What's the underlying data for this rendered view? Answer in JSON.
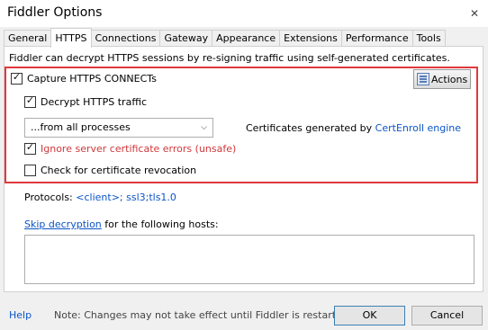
{
  "window": {
    "title": "Fiddler Options",
    "close_glyph": "✕"
  },
  "tabs": [
    {
      "label": "General"
    },
    {
      "label": "HTTPS"
    },
    {
      "label": "Connections"
    },
    {
      "label": "Gateway"
    },
    {
      "label": "Appearance"
    },
    {
      "label": "Extensions"
    },
    {
      "label": "Performance"
    },
    {
      "label": "Tools"
    }
  ],
  "https": {
    "intro": "Fiddler can decrypt HTTPS sessions by re-signing traffic using self-generated certificates.",
    "capture": {
      "label": "Capture HTTPS CONNECTs",
      "checked": true
    },
    "actions_label": "Actions",
    "decrypt": {
      "label": "Decrypt HTTPS traffic",
      "checked": true
    },
    "process_filter": {
      "value": "...from all processes",
      "arrow": "⌵"
    },
    "certs_prefix": "Certificates generated by ",
    "certs_link": "CertEnroll engine",
    "ignore_errors": {
      "label": "Ignore server certificate errors (unsafe)",
      "checked": true
    },
    "revocation": {
      "label": "Check for certificate revocation",
      "checked": false
    },
    "protocols_label": "Protocols: ",
    "protocols_value": "<client>; ssl3;tls1.0",
    "skip_link": "Skip decryption",
    "skip_rest": " for the following hosts:",
    "hosts_value": ""
  },
  "footer": {
    "help_label": "Help",
    "note": "Note: Changes may not take effect until Fiddler is restarted.",
    "ok_label": "OK",
    "cancel_label": "Cancel"
  },
  "colors": {
    "highlight_border": "#e0393e",
    "link": "#0b55c7",
    "warning_text": "#d0383b"
  },
  "icons": {
    "actions": "certificate-icon",
    "checked": "checkmark-icon"
  }
}
